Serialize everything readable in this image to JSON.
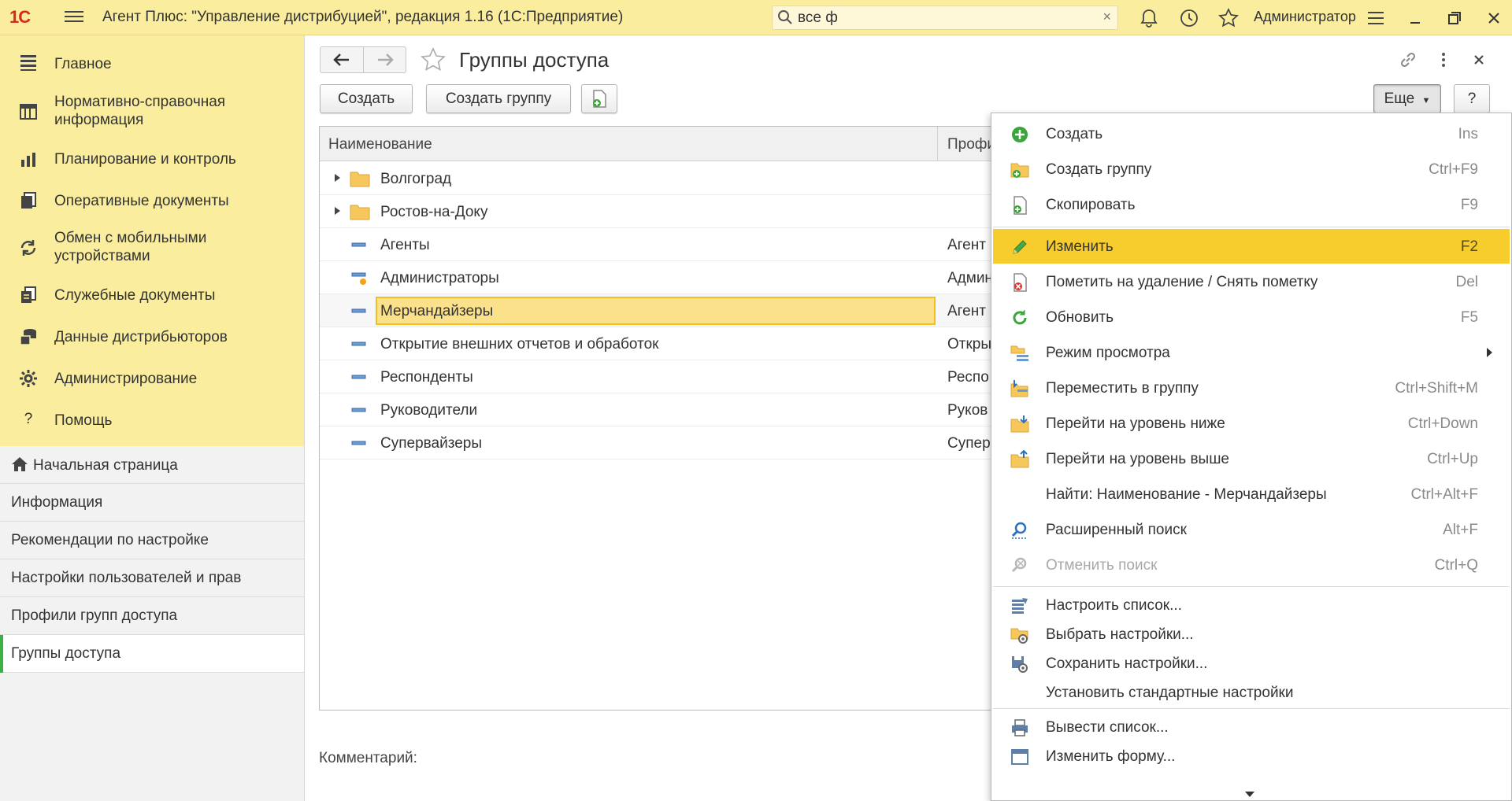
{
  "app": {
    "logo": "1С",
    "title": "Агент Плюс: \"Управление дистрибуцией\", редакция 1.16  (1С:Предприятие)",
    "search_value": "все ф",
    "search_clear": "×",
    "user": "Администратор"
  },
  "sections": [
    {
      "label": "Главное",
      "icon": "menu-list-icon"
    },
    {
      "label": "Нормативно-справочная информация",
      "icon": "catalog-icon"
    },
    {
      "label": "Планирование и контроль",
      "icon": "chart-icon"
    },
    {
      "label": "Оперативные документы",
      "icon": "documents-icon"
    },
    {
      "label": "Обмен с мобильными устройствами",
      "icon": "sync-icon"
    },
    {
      "label": "Служебные документы",
      "icon": "service-docs-icon"
    },
    {
      "label": "Данные дистрибьюторов",
      "icon": "distributor-data-icon"
    },
    {
      "label": "Администрирование",
      "icon": "gear-icon"
    },
    {
      "label": "Помощь",
      "icon": "help-icon"
    }
  ],
  "open_windows": [
    {
      "label": "Начальная страница",
      "icon": "home-icon"
    },
    {
      "label": "Информация"
    },
    {
      "label": "Рекомендации по настройке"
    },
    {
      "label": "Настройки пользователей и прав"
    },
    {
      "label": "Профили групп доступа"
    },
    {
      "label": "Группы доступа",
      "active": true
    }
  ],
  "form": {
    "title": "Группы доступа",
    "create_label": "Создать",
    "create_group_label": "Создать группу",
    "more_label": "Еще",
    "help_label": "?",
    "comment_label": "Комментарий:"
  },
  "grid": {
    "columns": [
      "Наименование",
      "Профи"
    ],
    "rows": [
      {
        "name": "Волгоград",
        "profile": "",
        "type": "folder"
      },
      {
        "name": "Ростов-на-Доку",
        "profile": "",
        "type": "folder"
      },
      {
        "name": "Агенты",
        "profile": "Агент",
        "type": "item"
      },
      {
        "name": "Администраторы",
        "profile": "Админ",
        "type": "item-user"
      },
      {
        "name": "Мерчандайзеры",
        "profile": "Агент",
        "type": "item",
        "selected": true
      },
      {
        "name": "Открытие внешних отчетов и обработок",
        "profile": "Откры",
        "type": "item"
      },
      {
        "name": "Респонденты",
        "profile": "Респо",
        "type": "item"
      },
      {
        "name": "Руководители",
        "profile": "Руков",
        "type": "item"
      },
      {
        "name": "Супервайзеры",
        "profile": "Супер",
        "type": "item"
      }
    ]
  },
  "menu": {
    "items": [
      {
        "label": "Создать",
        "key": "Ins",
        "icon": "add-circle-icon"
      },
      {
        "label": "Создать группу",
        "key": "Ctrl+F9",
        "icon": "add-folder-icon"
      },
      {
        "label": "Скопировать",
        "key": "F9",
        "icon": "copy-doc-icon"
      },
      {
        "label": "Изменить",
        "key": "F2",
        "icon": "pencil-icon",
        "highlighted": true
      },
      {
        "label": "Пометить на удаление / Снять пометку",
        "key": "Del",
        "icon": "mark-delete-icon"
      },
      {
        "label": "Обновить",
        "key": "F5",
        "icon": "refresh-icon"
      },
      {
        "label": "Режим просмотра",
        "key": "",
        "icon": "view-mode-icon",
        "submenu": true
      },
      {
        "label": "Переместить в группу",
        "key": "Ctrl+Shift+M",
        "icon": "move-to-group-icon"
      },
      {
        "label": "Перейти на уровень ниже",
        "key": "Ctrl+Down",
        "icon": "level-down-icon"
      },
      {
        "label": "Перейти на уровень выше",
        "key": "Ctrl+Up",
        "icon": "level-up-icon"
      },
      {
        "label": "Найти: Наименование - Мерчандайзеры",
        "key": "Ctrl+Alt+F",
        "icon": ""
      },
      {
        "label": "Расширенный поиск",
        "key": "Alt+F",
        "icon": "advanced-search-icon"
      },
      {
        "label": "Отменить поиск",
        "key": "Ctrl+Q",
        "icon": "cancel-search-icon",
        "disabled": true
      },
      {
        "label": "Настроить список...",
        "key": "",
        "icon": "list-settings-icon"
      },
      {
        "label": "Выбрать настройки...",
        "key": "",
        "icon": "choose-settings-icon"
      },
      {
        "label": "Сохранить настройки...",
        "key": "",
        "icon": "save-settings-icon"
      },
      {
        "label": "Установить стандартные настройки",
        "key": "",
        "icon": ""
      },
      {
        "label": "Вывести список...",
        "key": "",
        "icon": "print-list-icon"
      },
      {
        "label": "Изменить форму...",
        "key": "",
        "icon": "edit-form-icon"
      }
    ]
  },
  "colors": {
    "accent_yellow": "#fbed9e",
    "highlight": "#f7cd2d",
    "active_marker": "#3cb043",
    "green_icon": "#3aa53a"
  }
}
